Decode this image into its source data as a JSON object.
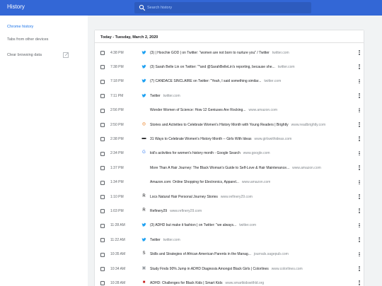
{
  "header": {
    "title": "History",
    "search_placeholder": "Search history"
  },
  "sidebar": {
    "items": [
      {
        "label": "Chrome history",
        "active": true
      },
      {
        "label": "Tabs from other devices",
        "active": false
      },
      {
        "label": "Clear browsing data",
        "active": false
      }
    ]
  },
  "main": {
    "day_heading": "Today - Tuesday, March 2, 2020",
    "entries": [
      {
        "time": "4:38 PM",
        "title": "(3) | Hoochie GOD | on Twitter: \"women are not born to nurture you\" / Twitter",
        "domain": "twitter.com",
        "icon": "twitter-icon"
      },
      {
        "time": "7:38 PM",
        "title": "(3) Sarah Belle Lin on Twitter: \"*and @SarahBelleLin's reporting, because she...",
        "domain": "twitter.com",
        "icon": "twitter-icon"
      },
      {
        "time": "7:18 PM",
        "title": "(7) CANDACE SINCLAIRE on Twitter: \"Yeah, I said something similar...",
        "domain": "twitter.com",
        "icon": "twitter-icon"
      },
      {
        "time": "7:11 PM",
        "title": "Twitter",
        "domain": "twitter.com",
        "icon": "twitter-icon"
      },
      {
        "time": "2:56 PM",
        "title": "Wonder Women of Science: How 12 Geniuses Are Rocking...",
        "domain": "www.amazon.com",
        "icon": "none"
      },
      {
        "time": "2:50 PM",
        "title": "Stories and Activities to Celebrate Women's History Month with Young Readers | Brightly",
        "domain": "www.readbrightly.com",
        "icon": "brightly-icon"
      },
      {
        "time": "2:38 PM",
        "title": "31 Ways to Celebrate Women's History Month -- Girls With Ideas",
        "domain": "www.girlswithideas.com",
        "icon": "gwi-icon"
      },
      {
        "time": "2:34 PM",
        "title": "kid's activities for women's history month - Google Search",
        "domain": "www.google.com",
        "icon": "google-icon"
      },
      {
        "time": "1:37 PM",
        "title": "More Than A Hair Journey: The Black Woman's Guide to Self-Love & Hair Maintenance...",
        "domain": "www.amazon.com",
        "icon": "none"
      },
      {
        "time": "1:34 PM",
        "title": "Amazon.com: Online Shopping for Electronics, Apparel...",
        "domain": "www.amazon.com",
        "icon": "none"
      },
      {
        "time": "1:10 PM",
        "title": "Locs Natural Hair Personal Journey Stories",
        "domain": "www.refinery29.com",
        "icon": "refinery29-icon"
      },
      {
        "time": "1:03 PM",
        "title": "Refinery29",
        "domain": "www.refinery29.com",
        "icon": "refinery29-icon"
      },
      {
        "time": "11:28 AM",
        "title": "(3) ADHD but make it fashion | on Twitter: \"we always...",
        "domain": "twitter.com",
        "icon": "twitter-icon"
      },
      {
        "time": "11:22 AM",
        "title": "Twitter",
        "domain": "twitter.com",
        "icon": "twitter-icon"
      },
      {
        "time": "10:35 AM",
        "title": "Skills and Strategies of African American Parents in the Manag...",
        "domain": "journals.sagepub.com",
        "icon": "sage-icon"
      },
      {
        "time": "10:34 AM",
        "title": "Study Finds 90% Jump in ADHD Diagnosis Amongst Black Girls | Colorlines",
        "domain": "www.colorlines.com",
        "icon": "colorlines-icon"
      },
      {
        "time": "10:28 AM",
        "title": "ADHD: Challenges for Black Kids | Smart Kids",
        "domain": "www.smartkidswithld.org",
        "icon": "smartkids-icon"
      }
    ]
  },
  "colors": {
    "topbar": "#3367d6",
    "accent": "#1a73e8",
    "twitter": "#1da1f2"
  }
}
